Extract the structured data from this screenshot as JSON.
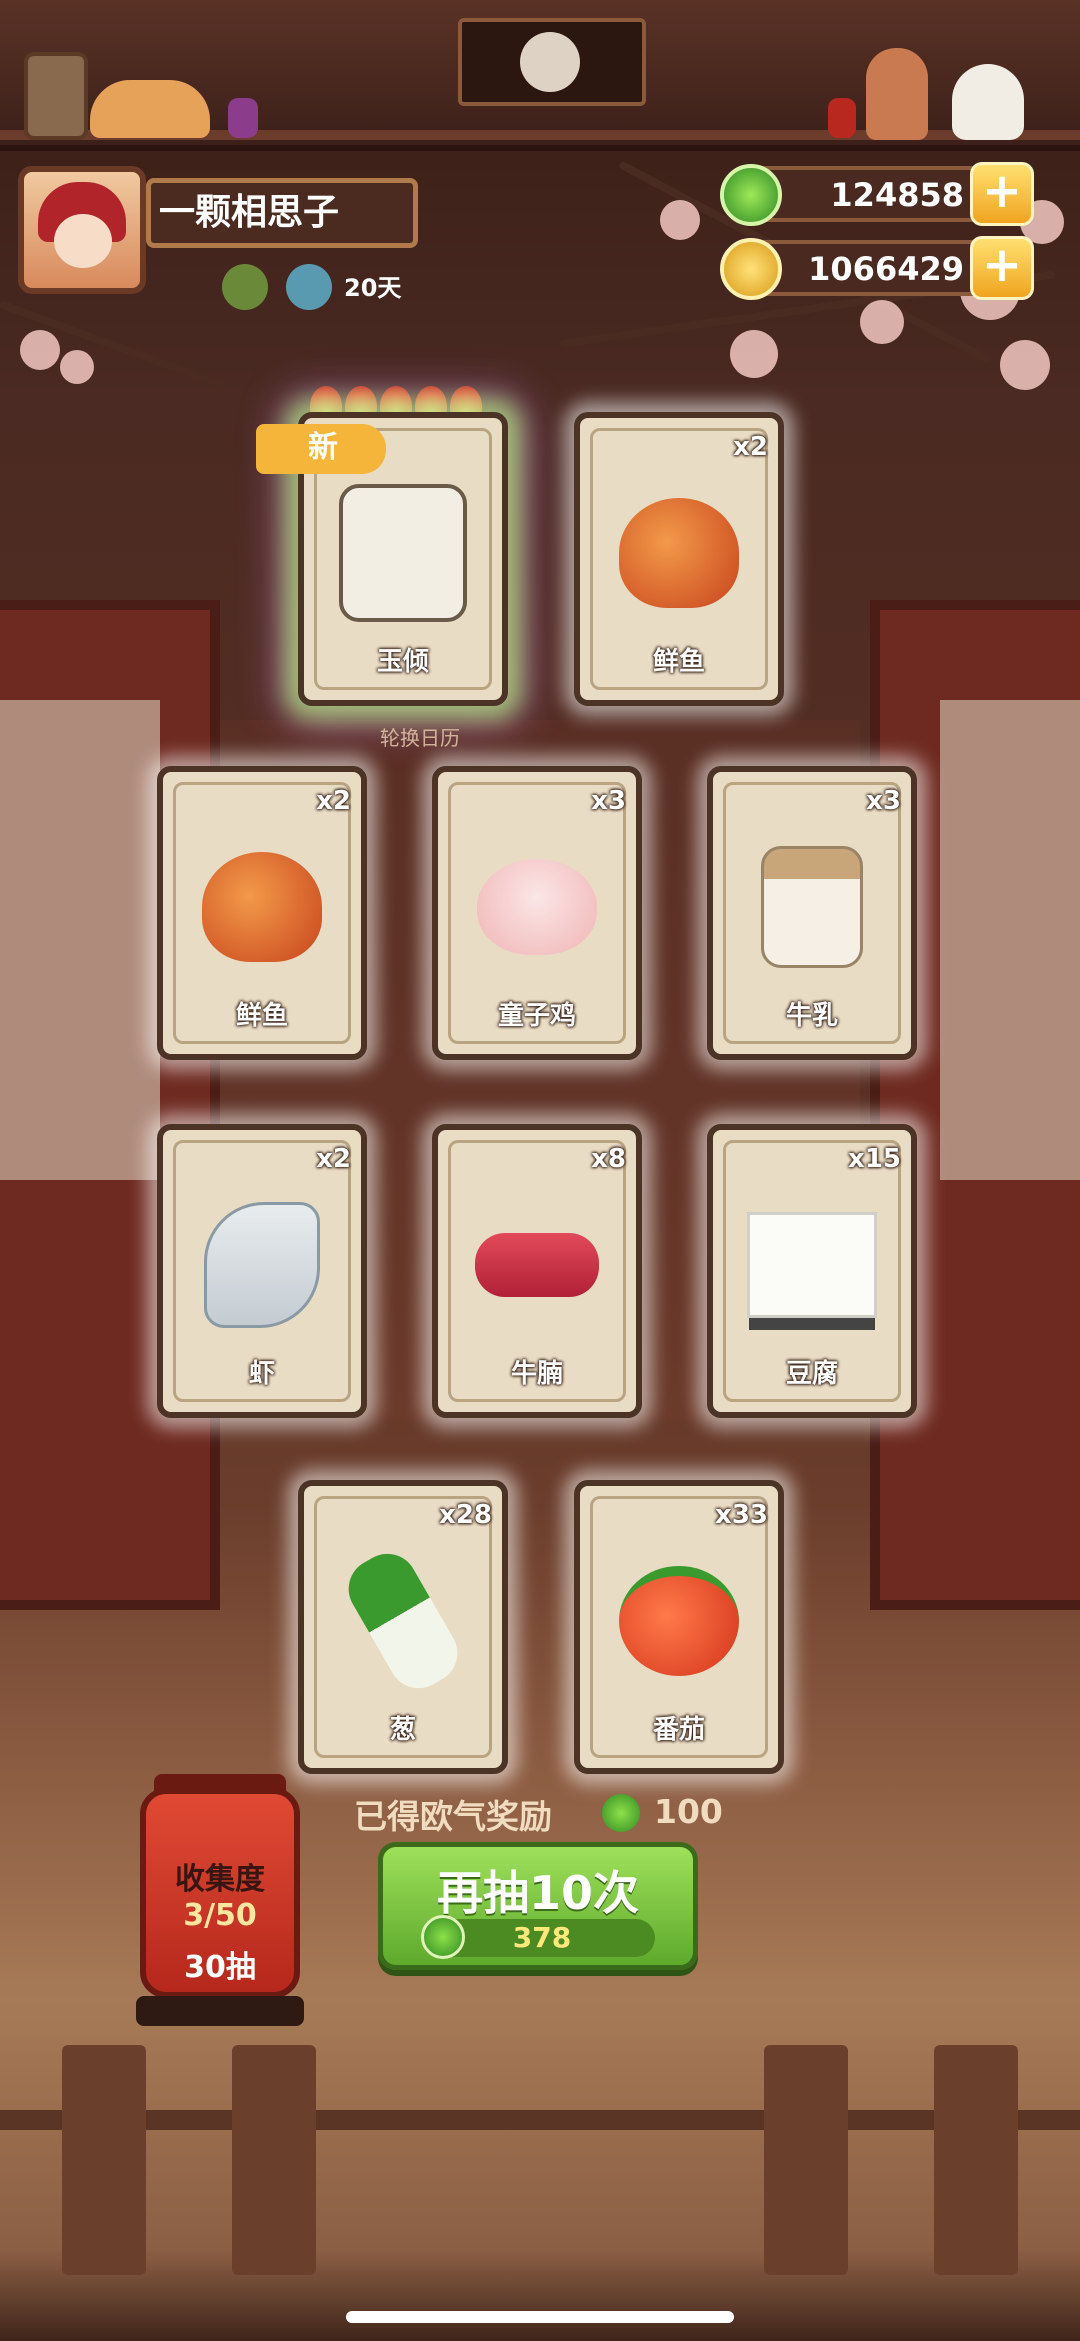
{
  "header": {
    "player_name": "一颗相思子",
    "streak_days": "20天",
    "currencies": [
      {
        "name": "jade",
        "value": "124858",
        "color": "#3fae2c"
      },
      {
        "name": "gold",
        "value": "1066429",
        "color": "#f3c233"
      }
    ]
  },
  "draw_results": {
    "new_label": "新",
    "rarity_flames": 5,
    "caption": "轮换日历",
    "cards": [
      {
        "name": "玉倾",
        "qty": "",
        "icon": "character-icon",
        "special": true
      },
      {
        "name": "鲜鱼",
        "qty": "x2",
        "icon": "fish-icon"
      },
      {
        "name": "鲜鱼",
        "qty": "x2",
        "icon": "fish-icon"
      },
      {
        "name": "童子鸡",
        "qty": "x3",
        "icon": "chicken-icon"
      },
      {
        "name": "牛乳",
        "qty": "x3",
        "icon": "milk-jar-icon"
      },
      {
        "name": "虾",
        "qty": "x2",
        "icon": "shrimp-icon"
      },
      {
        "name": "牛腩",
        "qty": "x8",
        "icon": "beef-icon"
      },
      {
        "name": "豆腐",
        "qty": "x15",
        "icon": "tofu-icon"
      },
      {
        "name": "葱",
        "qty": "x28",
        "icon": "scallion-icon"
      },
      {
        "name": "番茄",
        "qty": "x33",
        "icon": "tomato-icon"
      }
    ]
  },
  "reward": {
    "label": "已得欧气奖励",
    "value": "100"
  },
  "draw_button": {
    "label": "再抽10次",
    "cost": "378"
  },
  "collection": {
    "title": "收集度",
    "progress": "3/50",
    "draws": "30抽"
  }
}
